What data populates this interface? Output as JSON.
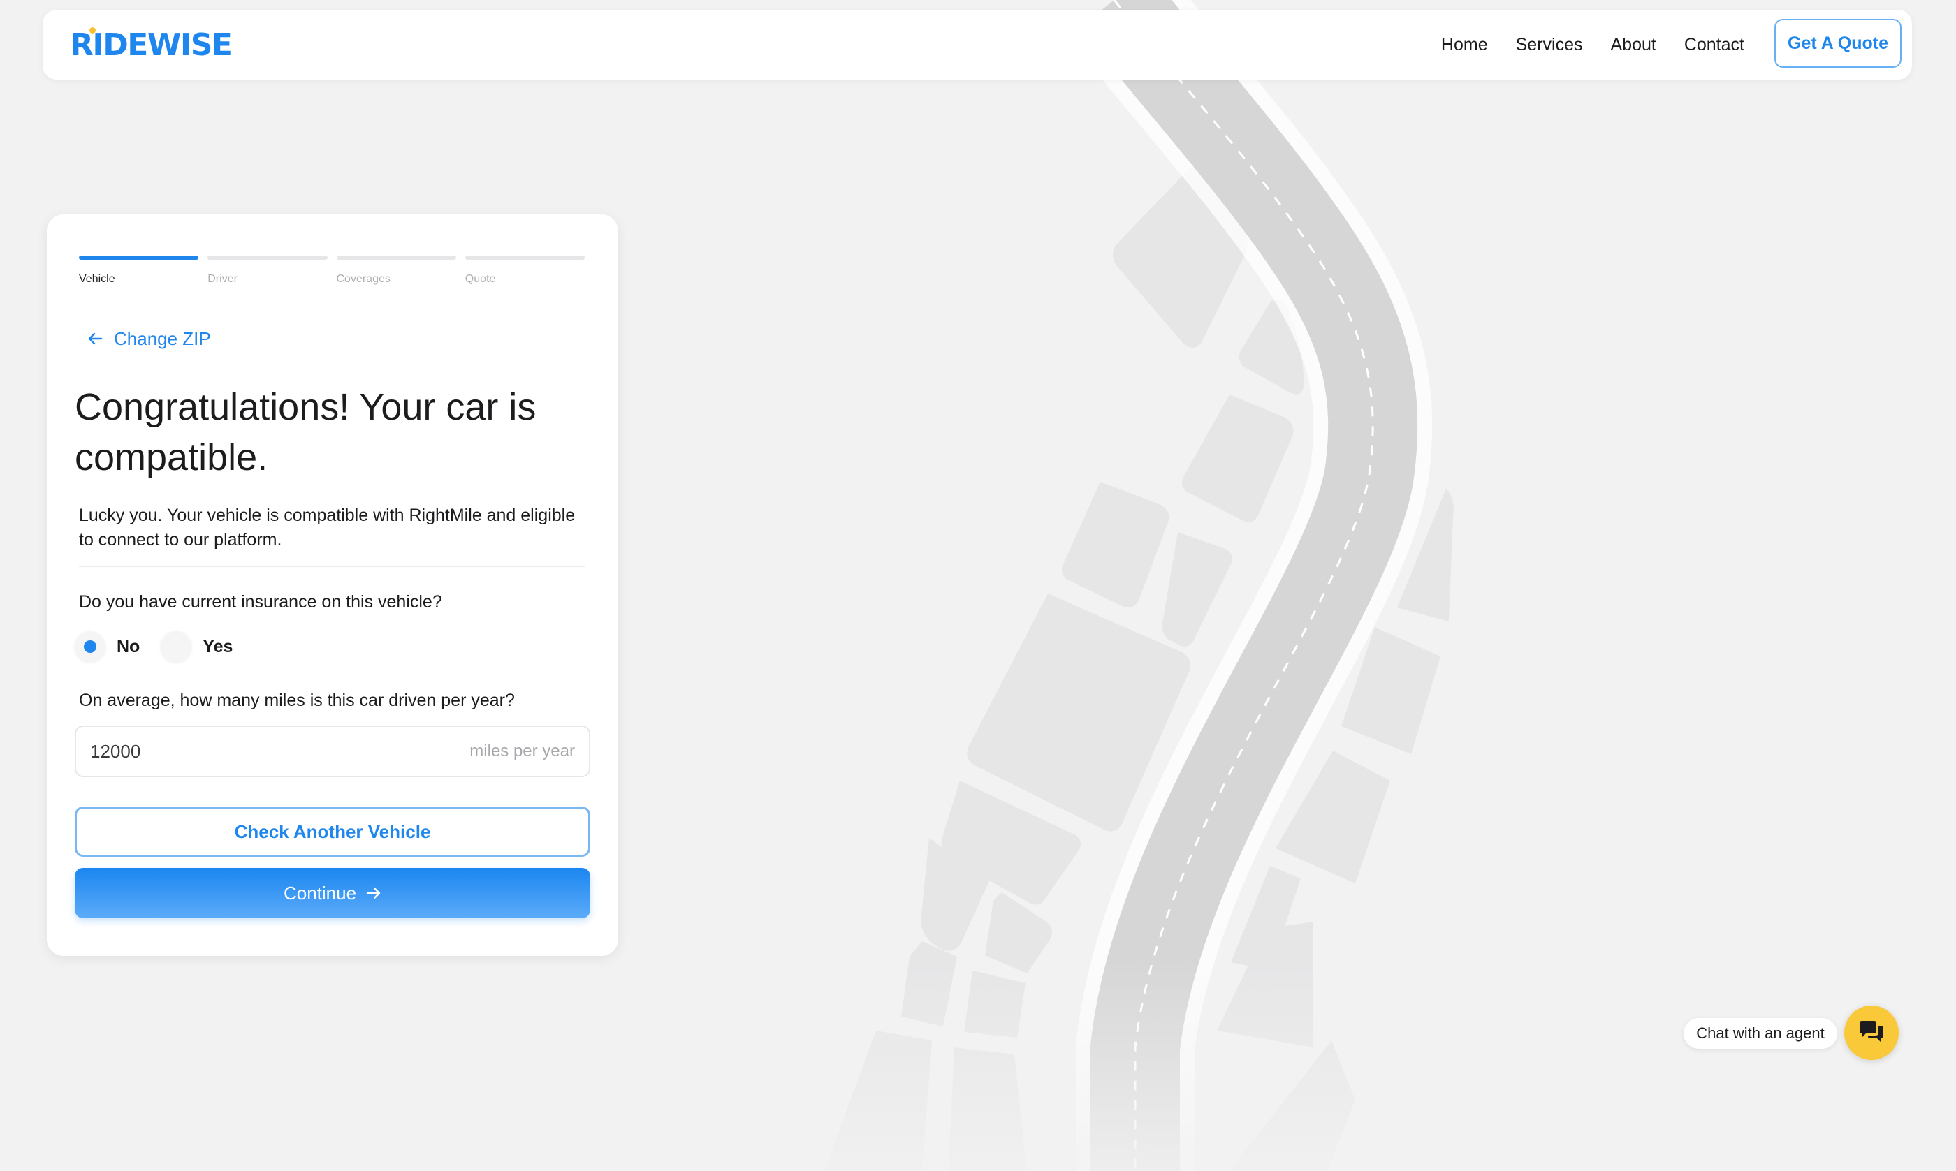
{
  "nav": {
    "logo": "RIDEWISE",
    "links": [
      "Home",
      "Services",
      "About",
      "Contact"
    ],
    "cta": "Get A Quote"
  },
  "steps": [
    {
      "label": "Vehicle",
      "active": true
    },
    {
      "label": "Driver",
      "active": false
    },
    {
      "label": "Coverages",
      "active": false
    },
    {
      "label": "Quote",
      "active": false
    }
  ],
  "form": {
    "back_link": "Change ZIP",
    "headline": "Congratulations! Your car is compatible.",
    "description": "Lucky you. Your vehicle is compatible with RightMile and eligible to connect to our platform.",
    "insurance_question": "Do you have current insurance on this vehicle?",
    "insurance_options": [
      "No",
      "Yes"
    ],
    "insurance_selected": "No",
    "miles_question": "On average, how many miles is this car driven per year?",
    "miles_value": "12000",
    "miles_suffix": "miles per year",
    "secondary_button": "Check Another Vehicle",
    "primary_button": "Continue"
  },
  "chat": {
    "label": "Chat with an agent"
  },
  "colors": {
    "accent": "#1f86ee",
    "chat": "#f9c93a",
    "background": "#f2f2f2"
  }
}
